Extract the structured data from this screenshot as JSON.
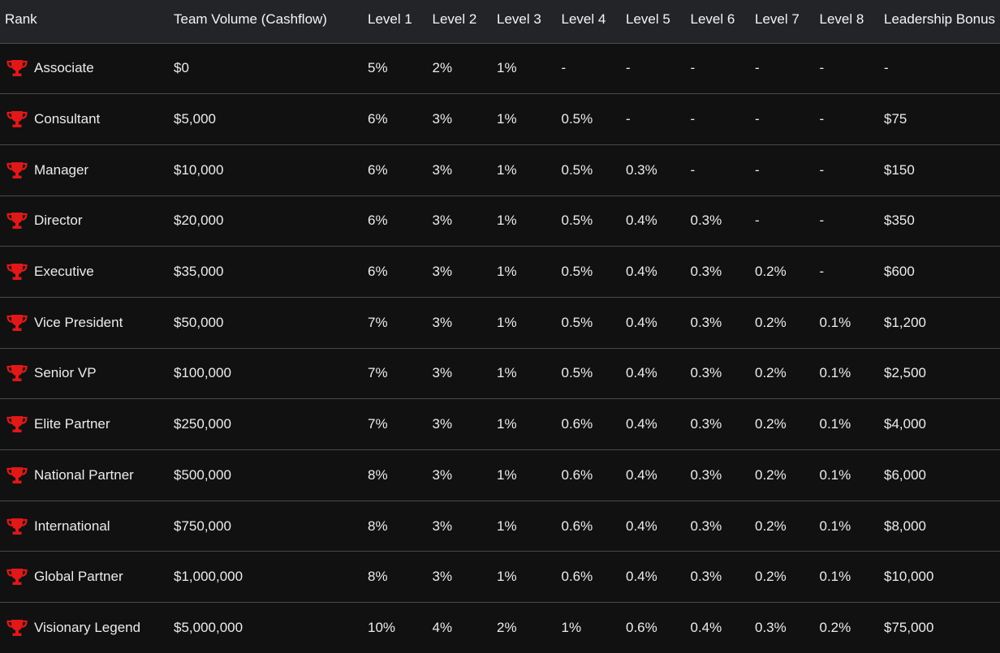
{
  "accent_color": "#e01818",
  "headers": [
    "Rank",
    "Team Volume (Cashflow)",
    "Level 1",
    "Level 2",
    "Level 3",
    "Level 4",
    "Level 5",
    "Level 6",
    "Level 7",
    "Level 8",
    "Leadership Bonus"
  ],
  "rows": [
    {
      "icon": "trophy-icon",
      "rank": "Associate",
      "volume": "$0",
      "levels": [
        "5%",
        "2%",
        "1%",
        "-",
        "-",
        "-",
        "-",
        "-"
      ],
      "bonus": "-"
    },
    {
      "icon": "trophy-icon",
      "rank": "Consultant",
      "volume": "$5,000",
      "levels": [
        "6%",
        "3%",
        "1%",
        "0.5%",
        "-",
        "-",
        "-",
        "-"
      ],
      "bonus": "$75"
    },
    {
      "icon": "trophy-icon",
      "rank": "Manager",
      "volume": "$10,000",
      "levels": [
        "6%",
        "3%",
        "1%",
        "0.5%",
        "0.3%",
        "-",
        "-",
        "-"
      ],
      "bonus": "$150"
    },
    {
      "icon": "trophy-icon",
      "rank": "Director",
      "volume": "$20,000",
      "levels": [
        "6%",
        "3%",
        "1%",
        "0.5%",
        "0.4%",
        "0.3%",
        "-",
        "-"
      ],
      "bonus": "$350"
    },
    {
      "icon": "trophy-icon",
      "rank": "Executive",
      "volume": "$35,000",
      "levels": [
        "6%",
        "3%",
        "1%",
        "0.5%",
        "0.4%",
        "0.3%",
        "0.2%",
        "-"
      ],
      "bonus": "$600"
    },
    {
      "icon": "trophy-icon",
      "rank": "Vice President",
      "volume": "$50,000",
      "levels": [
        "7%",
        "3%",
        "1%",
        "0.5%",
        "0.4%",
        "0.3%",
        "0.2%",
        "0.1%"
      ],
      "bonus": "$1,200"
    },
    {
      "icon": "trophy-icon",
      "rank": "Senior VP",
      "volume": "$100,000",
      "levels": [
        "7%",
        "3%",
        "1%",
        "0.5%",
        "0.4%",
        "0.3%",
        "0.2%",
        "0.1%"
      ],
      "bonus": "$2,500"
    },
    {
      "icon": "trophy-icon",
      "rank": "Elite Partner",
      "volume": "$250,000",
      "levels": [
        "7%",
        "3%",
        "1%",
        "0.6%",
        "0.4%",
        "0.3%",
        "0.2%",
        "0.1%"
      ],
      "bonus": "$4,000"
    },
    {
      "icon": "trophy-icon",
      "rank": "National Partner",
      "volume": "$500,000",
      "levels": [
        "8%",
        "3%",
        "1%",
        "0.6%",
        "0.4%",
        "0.3%",
        "0.2%",
        "0.1%"
      ],
      "bonus": "$6,000"
    },
    {
      "icon": "trophy-icon",
      "rank": "International",
      "volume": "$750,000",
      "levels": [
        "8%",
        "3%",
        "1%",
        "0.6%",
        "0.4%",
        "0.3%",
        "0.2%",
        "0.1%"
      ],
      "bonus": "$8,000"
    },
    {
      "icon": "trophy-icon",
      "rank": "Global Partner",
      "volume": "$1,000,000",
      "levels": [
        "8%",
        "3%",
        "1%",
        "0.6%",
        "0.4%",
        "0.3%",
        "0.2%",
        "0.1%"
      ],
      "bonus": "$10,000"
    },
    {
      "icon": "trophy-icon",
      "rank": "Visionary Legend",
      "volume": "$5,000,000",
      "levels": [
        "10%",
        "4%",
        "2%",
        "1%",
        "0.6%",
        "0.4%",
        "0.3%",
        "0.2%"
      ],
      "bonus": "$75,000"
    }
  ]
}
